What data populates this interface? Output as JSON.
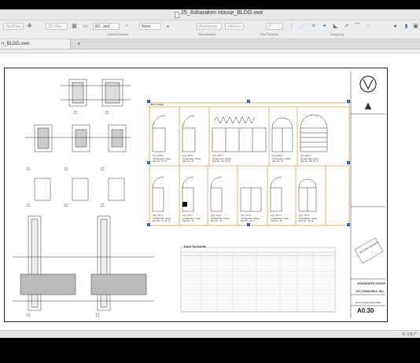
{
  "window": {
    "title": "25_Asharaken House_BLDG.vwx"
  },
  "toolbar": {
    "view": "Top/Plan",
    "render": "2D Plan",
    "layer": "A0...ale]",
    "class": "None",
    "render_mode": "Wireframe",
    "none_option": "<None>",
    "rotation": "0°",
    "groups": {
      "layers_classes": "Layers/Classes",
      "visualization": "Visualization",
      "plan_rotation": "Plan Rotation",
      "snapping": "Snapping"
    }
  },
  "tab": {
    "label": "n_BLDG.vwx"
  },
  "sheet": {
    "door_types_title": "Door Types",
    "door_schedule_title": "Door Schedule",
    "sheet_number": "A0.30",
    "project_name": "ASHARAKEN HOUSE",
    "firm": "VECTORWORKS, INC.",
    "drawing_title": "Door Details & Schedule",
    "stamp_text": "SECOND REVISION",
    "door_labels_top": [
      {
        "type": "Type: EXT-1",
        "config": "Configuration: Swing",
        "count": "Door No.: 01, 02"
      },
      {
        "type": "Type: EXT-2",
        "config": "Configuration: Swing",
        "count": "Door No.: 03"
      },
      {
        "type": "Type: EXT-3",
        "config": "Configuration: Sliding",
        "count": "Door No.: 04, 05, 06"
      },
      {
        "type": "Type: EXT-4",
        "config": "Configuration: Swing",
        "count": "Door No.: 07"
      },
      {
        "type": "Type: EXT-5",
        "config": "Configuration: Swing",
        "count": "Door No.: 08, 09, 10"
      }
    ],
    "door_labels_bottom": [
      {
        "type": "Type: INT-1",
        "config": "Configuration: Swing",
        "count": "Door No.: 11, 12, 13"
      },
      {
        "type": "Type: INT-2",
        "config": "Configuration: Swing",
        "count": "Door No.: 14"
      },
      {
        "type": "Type: INT-3",
        "config": "Configuration: Pocket",
        "count": "Door No.: 15"
      },
      {
        "type": "Type: INT-4",
        "config": "Configuration: Sliding",
        "count": "Door No.: 16, 17"
      },
      {
        "type": "Type: INT-5",
        "config": "Configuration: Swing",
        "count": "Door No.: 18"
      },
      {
        "type": "Type: INT-6",
        "config": "Configuration: Swing",
        "count": "Door No.: 19, 20"
      }
    ]
  },
  "status": {
    "coord": "X: 1'9.7\""
  },
  "icons": {
    "logo": "vectorworks-logo",
    "north": "north-arrow-icon"
  }
}
